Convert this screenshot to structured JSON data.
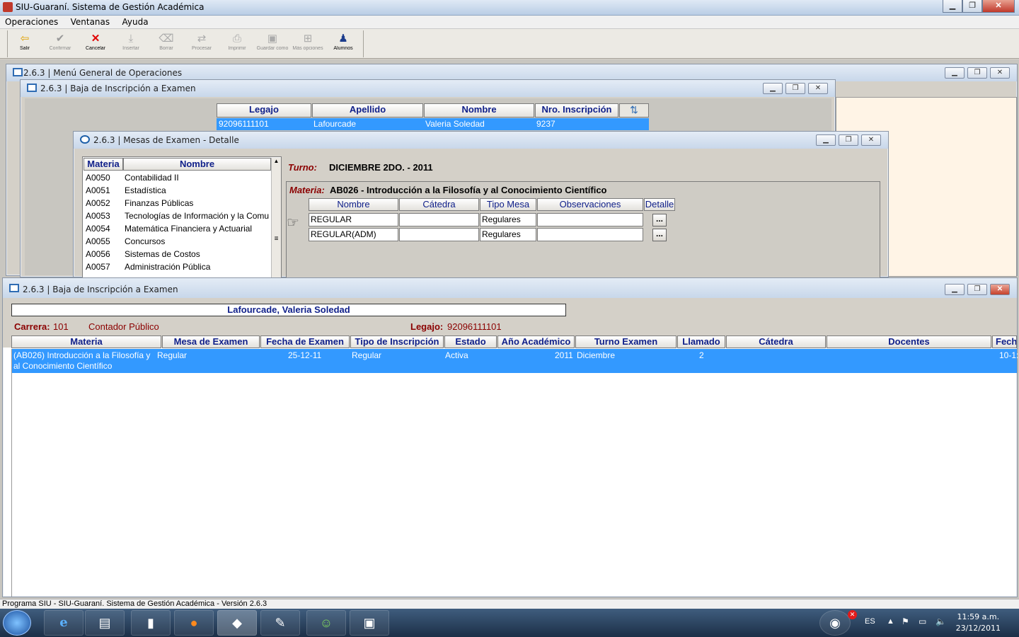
{
  "app": {
    "title": "SIU-Guaraní. Sistema de Gestión Académica"
  },
  "menu": [
    "Operaciones",
    "Ventanas",
    "Ayuda"
  ],
  "toolbar": [
    {
      "label": "Salir",
      "icon": "exit-arrow-icon",
      "active": true
    },
    {
      "label": "Confirmar",
      "icon": "check-icon",
      "active": false
    },
    {
      "label": "Cancelar",
      "icon": "red-x-icon",
      "active": true
    },
    {
      "label": "Insertar",
      "icon": "insert-icon",
      "active": false
    },
    {
      "label": "Borrar",
      "icon": "eraser-icon",
      "active": false
    },
    {
      "label": "Procesar",
      "icon": "process-icon",
      "active": false
    },
    {
      "label": "Imprimir",
      "icon": "printer-icon",
      "active": false
    },
    {
      "label": "Guardar como",
      "icon": "save-icon",
      "active": false
    },
    {
      "label": "Más opciones",
      "icon": "more-options-icon",
      "active": false
    },
    {
      "label": "Alumnos",
      "icon": "student-icon",
      "active": true
    }
  ],
  "win_menu": {
    "title": "2.6.3 | Menú General de Operaciones"
  },
  "win_baja_back": {
    "title": "2.6.3 | Baja de Inscripción a Examen",
    "columns": [
      "Legajo",
      "Apellido",
      "Nombre",
      "Nro. Inscripción"
    ],
    "row": [
      "92096111101",
      "Lafourcade",
      "Valeria Soledad",
      "9237"
    ]
  },
  "win_mesas": {
    "title": "2.6.3 | Mesas de Examen - Detalle",
    "list_columns": [
      "Materia",
      "Nombre"
    ],
    "list": [
      [
        "A0050",
        "Contabilidad II"
      ],
      [
        "A0051",
        "Estadística"
      ],
      [
        "A0052",
        "Finanzas Públicas"
      ],
      [
        "A0053",
        "Tecnologías de Información y la Comu"
      ],
      [
        "A0054",
        "Matemática Financiera y Actuarial"
      ],
      [
        "A0055",
        "Concursos"
      ],
      [
        "A0056",
        "Sistemas de Costos"
      ],
      [
        "A0057",
        "Administración Pública"
      ]
    ],
    "turno_label": "Turno:",
    "turno_value": "DICIEMBRE 2DO. - 2011",
    "materia_label": "Materia:",
    "materia_value": "AB026 - Introducción a la Filosofía y al Conocimiento Científico",
    "grid_columns": [
      "Nombre",
      "Cátedra",
      "Tipo Mesa",
      "Observaciones",
      "Detalle"
    ],
    "grid_rows": [
      {
        "nombre": "REGULAR",
        "catedra": "",
        "tipo": "Regulares",
        "obs": "",
        "btn": "..."
      },
      {
        "nombre": "REGULAR(ADM)",
        "catedra": "",
        "tipo": "Regulares",
        "obs": "",
        "btn": "..."
      }
    ]
  },
  "win_baja_front": {
    "title": "2.6.3 | Baja de Inscripción a Examen",
    "student": "Lafourcade, Valeria Soledad",
    "carrera_label": "Carrera:",
    "carrera_code": "101",
    "carrera_name": "Contador Público",
    "legajo_label": "Legajo:",
    "legajo_value": "92096111101",
    "columns": [
      "Materia",
      "Mesa de Examen",
      "Fecha de Examen",
      "Tipo de Inscripción",
      "Estado",
      "Año Académico",
      "Turno Examen",
      "Llamado",
      "Cátedra",
      "Docentes",
      "Fech"
    ],
    "row": {
      "materia": "(AB026) Introducción a la Filosofía y al Conocimiento Científico",
      "mesa": "Regular",
      "fecha": "25-12-11",
      "tipo": "Regular",
      "estado": "Activa",
      "anio": "2011",
      "turno": "Diciembre",
      "llamado": "2",
      "fech": "10-1:"
    }
  },
  "status": "Programa SIU - SIU-Guaraní. Sistema de Gestión Académica - Versión 2.6.3",
  "taskbar": {
    "lang": "ES",
    "time": "11:59 a.m.",
    "date": "23/12/2011"
  },
  "colors": {
    "selection": "#3399ff",
    "header_text": "#10208a",
    "label_red": "#8b0000"
  }
}
